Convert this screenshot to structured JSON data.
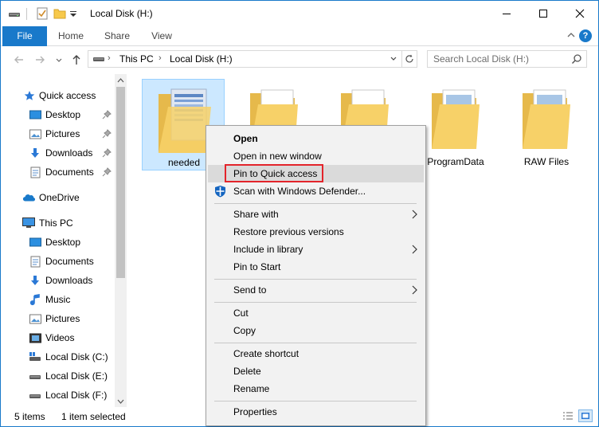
{
  "window": {
    "title": "Local Disk (H:)",
    "accent": "#1979ca",
    "controls": [
      "minimize",
      "maximize",
      "close"
    ]
  },
  "ribbon": {
    "tabs": [
      {
        "label": "File",
        "active": true
      },
      {
        "label": "Home"
      },
      {
        "label": "Share"
      },
      {
        "label": "View"
      }
    ],
    "help_label": "?"
  },
  "address_bar": {
    "breadcrumbs": [
      "This PC",
      "Local Disk (H:)"
    ],
    "search_placeholder": "Search Local Disk (H:)"
  },
  "nav_pane": {
    "items": [
      {
        "label": "Quick access",
        "icon": "star-icon",
        "pinned": false
      },
      {
        "label": "Desktop",
        "icon": "desktop-icon",
        "pinned": true
      },
      {
        "label": "Pictures",
        "icon": "pictures-icon",
        "pinned": true
      },
      {
        "label": "Downloads",
        "icon": "downloads-icon",
        "pinned": true
      },
      {
        "label": "Documents",
        "icon": "documents-icon",
        "pinned": true
      },
      {
        "label": "OneDrive",
        "icon": "onedrive-icon",
        "pinned": false
      },
      {
        "label": "This PC",
        "icon": "pc-icon",
        "pinned": false
      },
      {
        "label": "Desktop",
        "icon": "desktop-icon",
        "pinned": false
      },
      {
        "label": "Documents",
        "icon": "documents-icon",
        "pinned": false
      },
      {
        "label": "Downloads",
        "icon": "downloads-icon",
        "pinned": false
      },
      {
        "label": "Music",
        "icon": "music-icon",
        "pinned": false
      },
      {
        "label": "Pictures",
        "icon": "pictures-icon",
        "pinned": false
      },
      {
        "label": "Videos",
        "icon": "videos-icon",
        "pinned": false
      },
      {
        "label": "Local Disk (C:)",
        "icon": "windows-drive-icon",
        "pinned": false
      },
      {
        "label": "Local Disk (E:)",
        "icon": "drive-icon",
        "pinned": false
      },
      {
        "label": "Local Disk (F:)",
        "icon": "drive-icon",
        "pinned": false
      }
    ]
  },
  "folders": [
    {
      "name": "needed",
      "selected": true,
      "style": "documents"
    },
    {
      "name": "",
      "selected": false,
      "style": "papers"
    },
    {
      "name": "",
      "selected": false,
      "style": "papers"
    },
    {
      "name": "ProgramData",
      "selected": false,
      "style": "files"
    },
    {
      "name": "RAW Files",
      "selected": false,
      "style": "files"
    }
  ],
  "context_menu": {
    "items": [
      {
        "label": "Open",
        "bold": true
      },
      {
        "label": "Open in new window"
      },
      {
        "label": "Pin to Quick access",
        "hover": true,
        "highlighted": true
      },
      {
        "label": "Scan with Windows Defender...",
        "icon": "defender-shield-icon"
      },
      {
        "label": "Share with",
        "submenu": true
      },
      {
        "label": "Restore previous versions"
      },
      {
        "label": "Include in library",
        "submenu": true
      },
      {
        "label": "Pin to Start"
      },
      {
        "label": "Send to",
        "submenu": true
      },
      {
        "label": "Cut"
      },
      {
        "label": "Copy"
      },
      {
        "label": "Create shortcut"
      },
      {
        "label": "Delete"
      },
      {
        "label": "Rename"
      },
      {
        "label": "Properties"
      }
    ],
    "highlight_color": "#e3242b"
  },
  "status_bar": {
    "item_count": "5 items",
    "selection": "1 item selected"
  }
}
